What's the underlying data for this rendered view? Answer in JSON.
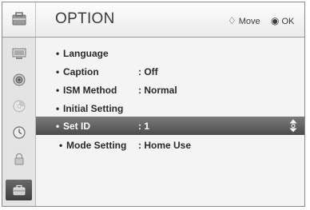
{
  "header": {
    "title": "OPTION",
    "move_glyph": "♢",
    "move_label": "Move",
    "ok_glyph": "◉",
    "ok_label": "OK",
    "icon": "option-toolbox-icon"
  },
  "sidebar": {
    "items": [
      {
        "icon": "picture-icon",
        "active": false
      },
      {
        "icon": "audio-speaker-icon",
        "active": false
      },
      {
        "icon": "channel-disc-icon",
        "active": false
      },
      {
        "icon": "clock-icon",
        "active": false
      },
      {
        "icon": "lock-icon",
        "active": false
      },
      {
        "icon": "option-toolbox-icon",
        "active": true
      }
    ]
  },
  "menu": {
    "bullet": "•",
    "items": [
      {
        "label": "Language",
        "value": ""
      },
      {
        "label": "Caption",
        "value": ": Off"
      },
      {
        "label": "ISM Method",
        "value": ": Normal"
      },
      {
        "label": "Initial Setting",
        "value": ""
      },
      {
        "label": "Set ID",
        "value": ": 1",
        "selected": true
      },
      {
        "label": "Mode Setting",
        "value": ": Home Use"
      }
    ]
  },
  "colors": {
    "selected_bg": "#5a5a5a",
    "text": "#2a2a2a"
  }
}
